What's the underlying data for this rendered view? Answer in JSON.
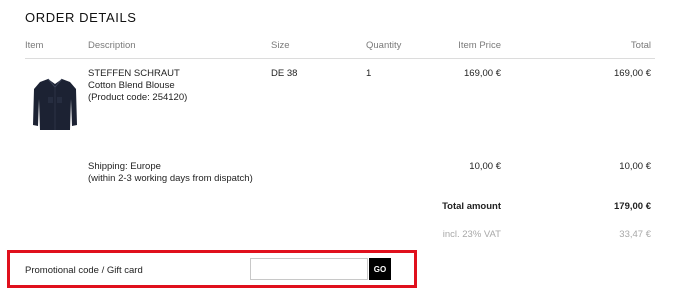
{
  "section_title": "ORDER DETAILS",
  "columns": {
    "item": "Item",
    "description": "Description",
    "size": "Size",
    "quantity": "Quantity",
    "item_price": "Item Price",
    "total": "Total"
  },
  "product": {
    "brand": "STEFFEN SCHRAUT",
    "name": "Cotton Blend Blouse",
    "code": "(Product code: 254120)",
    "size": "DE 38",
    "quantity": "1",
    "item_price": "169,00 €",
    "total": "169,00 €",
    "image_icon": "blouse-image",
    "image_color": "#1c2233"
  },
  "shipping": {
    "line1": "Shipping: Europe",
    "line2": "(within 2-3 working days from dispatch)",
    "item_price": "10,00 €",
    "total": "10,00 €"
  },
  "summary": {
    "total_label": "Total amount",
    "total_value": "179,00 €",
    "vat_label": "incl. 23% VAT",
    "vat_value": "33,47 €"
  },
  "promo": {
    "label": "Promotional code / Gift card",
    "input_value": "",
    "button_label": "GO",
    "highlight_color": "#e0101d"
  }
}
